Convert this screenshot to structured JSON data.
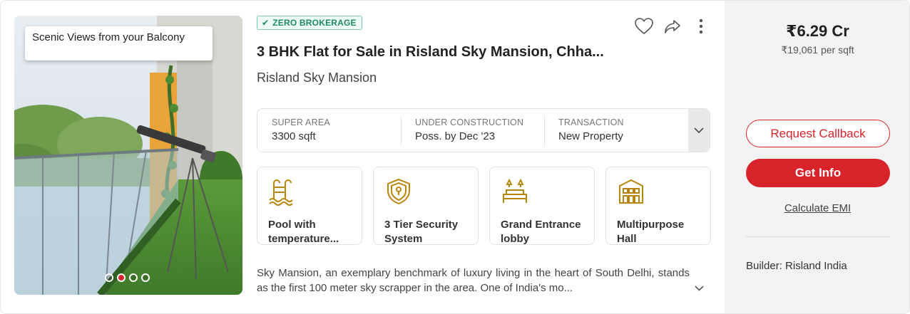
{
  "photo": {
    "tag": "Scenic Views from your Balcony",
    "dots": 4,
    "active_dot": 2
  },
  "badge": {
    "icon": "check-icon",
    "label": "ZERO BROKERAGE"
  },
  "title": "3 BHK Flat for Sale in Risland Sky Mansion, Chha...",
  "project": "Risland Sky Mansion",
  "actions": [
    "heart-icon",
    "share-icon",
    "more-vertical-icon"
  ],
  "specs": [
    {
      "label": "SUPER AREA",
      "value": "3300 sqft"
    },
    {
      "label": "UNDER CONSTRUCTION",
      "value": "Poss. by Dec '23"
    },
    {
      "label": "TRANSACTION",
      "value": "New Property"
    }
  ],
  "amenities": [
    {
      "icon": "pool-icon",
      "label": "Pool with temperature..."
    },
    {
      "icon": "security-shield-icon",
      "label": "3 Tier Security System"
    },
    {
      "icon": "lobby-icon",
      "label": "Grand Entrance lobby"
    },
    {
      "icon": "hall-icon",
      "label": "Multipurpose Hall"
    }
  ],
  "description": "Sky Mansion, an exemplary benchmark of luxury living in the heart of South Delhi, stands as the first 100 meter sky scrapper in the area. One of India's mo...",
  "side": {
    "price": "₹6.29 Cr",
    "price_per_sqft": "₹19,061 per sqft",
    "request_callback": "Request Callback",
    "get_info": "Get Info",
    "calculate_emi": "Calculate EMI",
    "builder": "Builder: Risland India"
  },
  "colors": {
    "accent": "#d8232a",
    "badge_green": "#1f8a6a",
    "amenity_gold": "#b8860b"
  }
}
